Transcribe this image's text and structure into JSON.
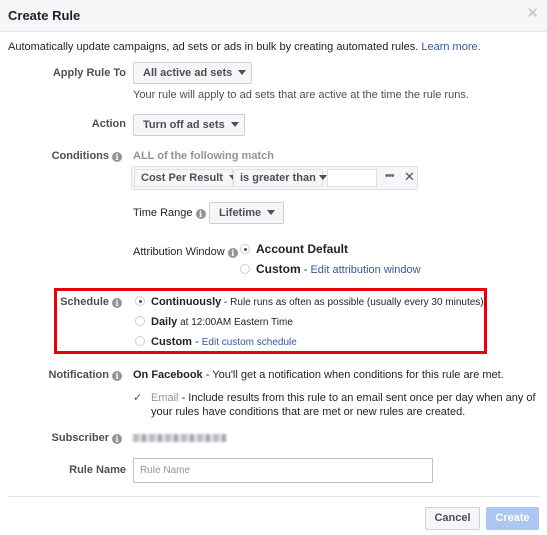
{
  "dialog": {
    "title": "Create Rule",
    "close_icon": "close-icon"
  },
  "intro": {
    "text": "Automatically update campaigns, ad sets or ads in bulk by creating automated rules.",
    "link": "Learn more."
  },
  "apply_rule_to": {
    "label": "Apply Rule To",
    "value": "All active ad sets",
    "help": "Your rule will apply to ad sets that are active at the time the rule runs."
  },
  "action": {
    "label": "Action",
    "value": "Turn off ad sets"
  },
  "conditions": {
    "label": "Conditions",
    "match_text": "ALL of the following match",
    "metric": "Cost Per Result",
    "operator": "is greater than",
    "value": "",
    "more_icon": "ellipsis-icon",
    "remove_icon": "close-icon"
  },
  "time_range": {
    "label": "Time Range",
    "value": "Lifetime"
  },
  "attribution_window": {
    "label": "Attribution Window",
    "options": [
      {
        "label": "Account Default",
        "selected": true
      },
      {
        "label": "Custom",
        "separator": " - ",
        "link": "Edit attribution window",
        "selected": false
      }
    ]
  },
  "schedule": {
    "label": "Schedule",
    "highlight_color": "#e8000b",
    "options": [
      {
        "label": "Continuously",
        "desc": " - Rule runs as often as possible (usually every 30 minutes).",
        "selected": true
      },
      {
        "label": "Daily",
        "desc": " at 12:00AM Eastern Time",
        "selected": false
      },
      {
        "label": "Custom",
        "desc": " - ",
        "link": "Edit custom schedule",
        "selected": false
      }
    ]
  },
  "notification": {
    "label": "Notification",
    "title": "On Facebook",
    "desc": " - You'll get a notification when conditions for this rule are met.",
    "email_checked": true,
    "email_label": "Email",
    "email_desc": " - Include results from this rule to an email sent once per day when any of your rules have conditions that are met or new rules are created."
  },
  "subscriber": {
    "label": "Subscriber"
  },
  "rule_name": {
    "label": "Rule Name",
    "value": "",
    "placeholder": "Rule Name"
  },
  "footer": {
    "cancel": "Cancel",
    "create": "Create"
  },
  "colors": {
    "link": "#365899",
    "primary_disabled": "#adc6f2"
  }
}
